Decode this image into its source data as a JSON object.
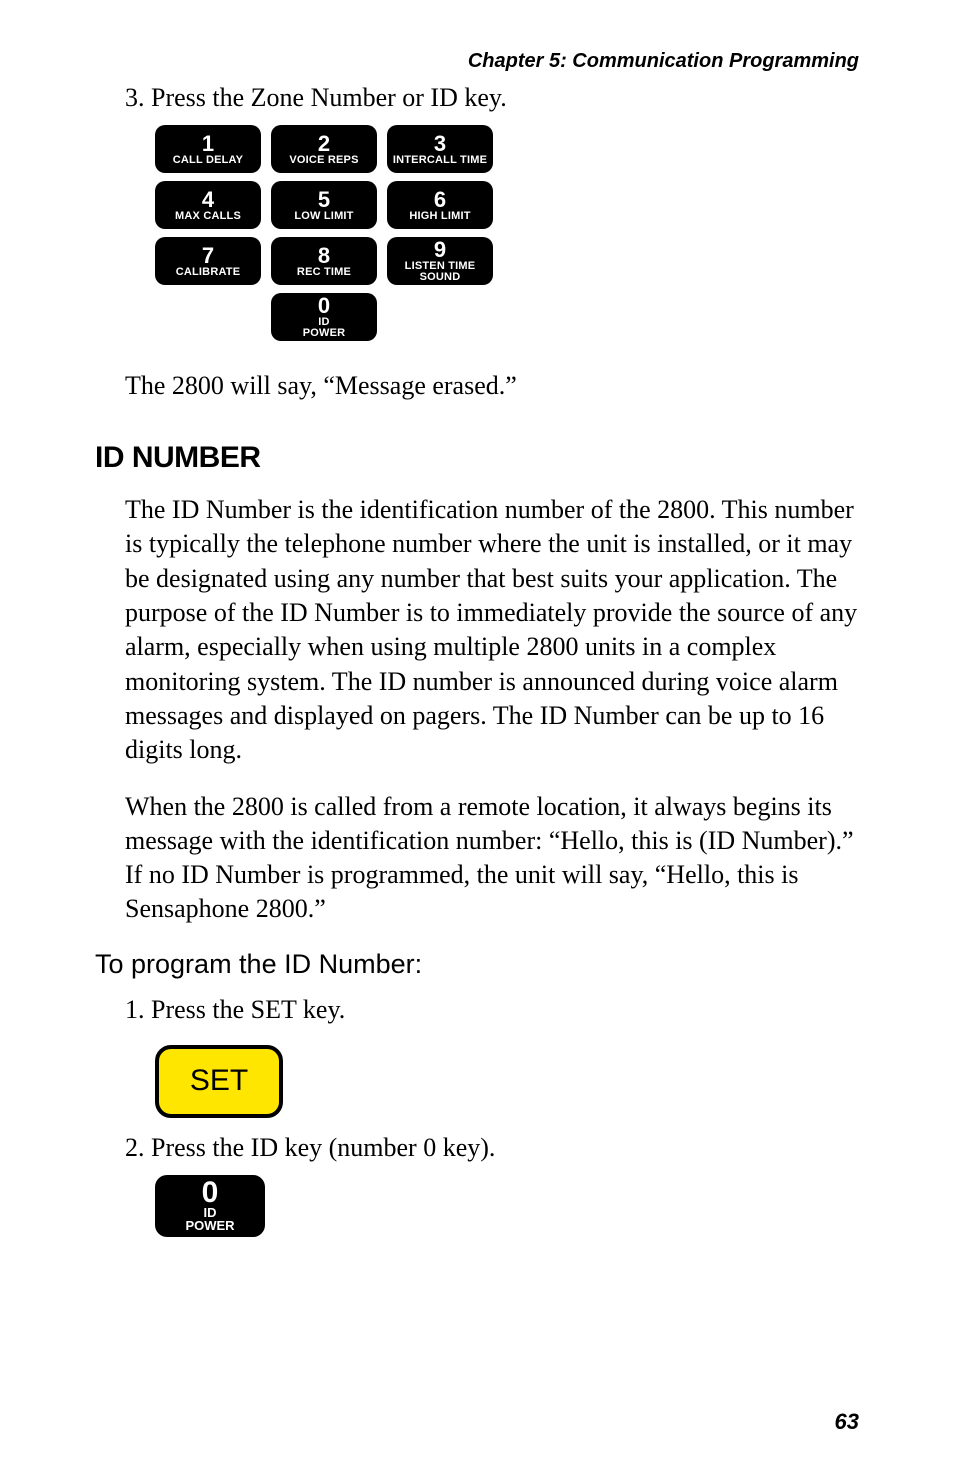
{
  "header_text": "Chapter 5: Communication Programming",
  "step3": "3. Press the Zone Number or ID key.",
  "keypad_rows": [
    [
      {
        "num": "1",
        "label": "CALL DELAY"
      },
      {
        "num": "2",
        "label": "VOICE REPS"
      },
      {
        "num": "3",
        "label": "INTERCALL TIME"
      }
    ],
    [
      {
        "num": "4",
        "label": "MAX CALLS"
      },
      {
        "num": "5",
        "label": "LOW LIMIT"
      },
      {
        "num": "6",
        "label": "HIGH LIMIT"
      }
    ],
    [
      {
        "num": "7",
        "label": "CALIBRATE"
      },
      {
        "num": "8",
        "label": "REC TIME"
      },
      {
        "num": "9",
        "label": "LISTEN TIME\nSOUND"
      }
    ]
  ],
  "key_zero": {
    "num": "0",
    "label_line1": "ID",
    "label_line2": "POWER"
  },
  "result_text": "The 2800 will say, “Message erased.”",
  "section_heading": "ID NUMBER",
  "para1": "The ID Number is the identification number of the 2800. This number is typically the telephone number where the unit is installed, or it may be designated using any number that best suits your application. The purpose of the ID Number is to immediately provide the source of any alarm, especially when using multiple 2800 units in a complex monitoring system. The ID number is announced during voice alarm messages and displayed on pagers. The ID Number can be up to 16 digits long.",
  "para2": "When the 2800 is called from a remote location, it always begins its message with the identification number: “Hello, this is (ID Number).” If no ID Number is programmed, the unit will say, “Hello, this is Sensaphone 2800.”",
  "subhead": "To program the ID Number:",
  "step1": "1. Press the SET key.",
  "set_key_label": "SET",
  "step2": "2. Press the ID key (number 0 key).",
  "page_number": "63"
}
